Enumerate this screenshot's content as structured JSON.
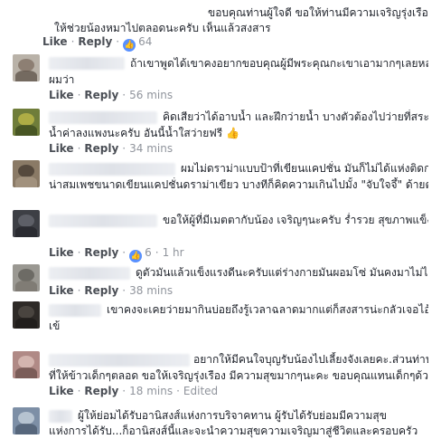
{
  "actions": {
    "like": "Like",
    "reply": "Reply",
    "dot": "·",
    "edited": "Edited"
  },
  "comments": [
    {
      "line1": "ขอบคุณท่านผู้ใจดี ขอให้ท่านมีความเจริญรุ่งเรืองนะ ขอ",
      "line2": "ให้ช่วยน้องหมาไปตลอดนะครับ เห็นแล้วสงสาร",
      "reaction_count": "64",
      "time": ""
    },
    {
      "line1": "ถ้าเขาพูดได้เขาคงอยากขอบคุณผู้มีพระคุณกะเขาเอามากๆเลยหล่ะ",
      "line2": "ผมว่า",
      "time": "56 mins"
    },
    {
      "line1": "คิดเสียว่าได้อาบน้ำ และฝึกว่ายน้ำ บางตัวต้องไปว่ายที่สระ",
      "line2": "น้ำค่าลงแพงนะครับ อันนี้น้ำใสว่ายฟรี",
      "emoji": "👍",
      "time": "34 mins"
    },
    {
      "line1": "ผมไม่ดราม่าแบบป้าที่เขียนแคปชั่น มันก็ไม่ได้แห่งติดกระดูก หรือขี้เรื้อนซะ",
      "line2": "น่าสมเพชขนาดเขียนแคปชั่นดราม่าเขียว บางทีก็คิดความเกินไปมั้ง \"จับใจจึ้\" ด้ายตาย",
      "time": ""
    },
    {
      "line1": "ขอให้ผู้ที่มีเมตตากับน้อง เจริญๆนะครับ ร่ำรวย สุขภาพแข็งแรง",
      "emoji": "♥♥",
      "reaction_count": "6",
      "time": "1 hr"
    },
    {
      "line1": "ดูตัวมันแล้วแข็งแรงดีนะครับแต่ร่างกายมันผอมโซ่ มันคงมาไม่ไหว",
      "time": "38 mins"
    },
    {
      "line1": "เขาคงจะเคยว่ายมากินบ่อยถึงรู้เวลาฉลาดมากแต่ก็สงสารน่ะกลัวเจอไอ้",
      "line2": "เข้",
      "time": ""
    },
    {
      "line1": "อยากให้มีคนใจบุญรับน้องไปเลี้ยงจังเลยคะ.ส่วนท่าน",
      "line2": "ที่ให้ข้าวเด็กๆตลอด ขอให้เจริญรุ่งเรือง มีความสุขมากๆนะคะ ขอบคุณแทนเด็กๆด้วยคะ",
      "time": "18 mins"
    },
    {
      "line1": "ผู้ให้ย่อมได้รับอานิสงส์แห่งการบริจาคทาน ผู้รับได้รับย่อมมีความสุข",
      "line2": "แห่งการได้รับ...ก็อานิสงส์นี้และจะนำความสุขความเจริญมาสู่ชีวิตและครอบครัว"
    }
  ],
  "colors": {
    "link": "#4b4f56",
    "meta": "#90949c",
    "reaction": "#5890ff",
    "heart": "#e0245e"
  }
}
